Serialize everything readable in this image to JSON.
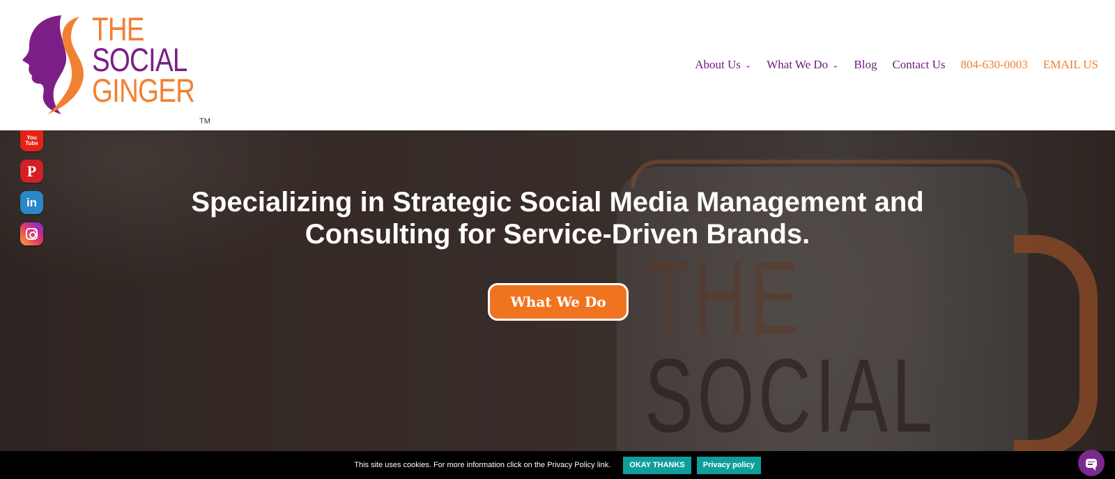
{
  "header": {
    "logo": {
      "line1": "THE",
      "line2": "SOCIAL",
      "line3": "GINGER",
      "trademark": "TM"
    },
    "nav": [
      {
        "label": "About Us",
        "has_dropdown": true
      },
      {
        "label": "What We Do",
        "has_dropdown": true
      },
      {
        "label": "Blog",
        "has_dropdown": false
      },
      {
        "label": "Contact Us",
        "has_dropdown": false
      },
      {
        "label": "804-630-0003",
        "has_dropdown": false
      },
      {
        "label": "EMAIL US",
        "has_dropdown": false
      }
    ],
    "caret": "⌄"
  },
  "social": {
    "youtube_line1": "You",
    "youtube_line2": "Tube",
    "pinterest": "P",
    "linkedin": "in"
  },
  "hero": {
    "title": "Specializing in Strategic Social Media Management and Consulting for Service-Driven Brands.",
    "cta_label": "What We Do",
    "mug_text_line1": "THE",
    "mug_text_line2": "SOCIAL"
  },
  "cookie": {
    "message": "This site uses cookies. For more information click on the Privacy Policy link.",
    "accept_label": "OKAY THANKS",
    "policy_label": "Privacy policy"
  },
  "colors": {
    "brand_purple": "#6b1a7a",
    "brand_orange": "#f07f2c",
    "cookie_button": "#0f9e9b"
  }
}
